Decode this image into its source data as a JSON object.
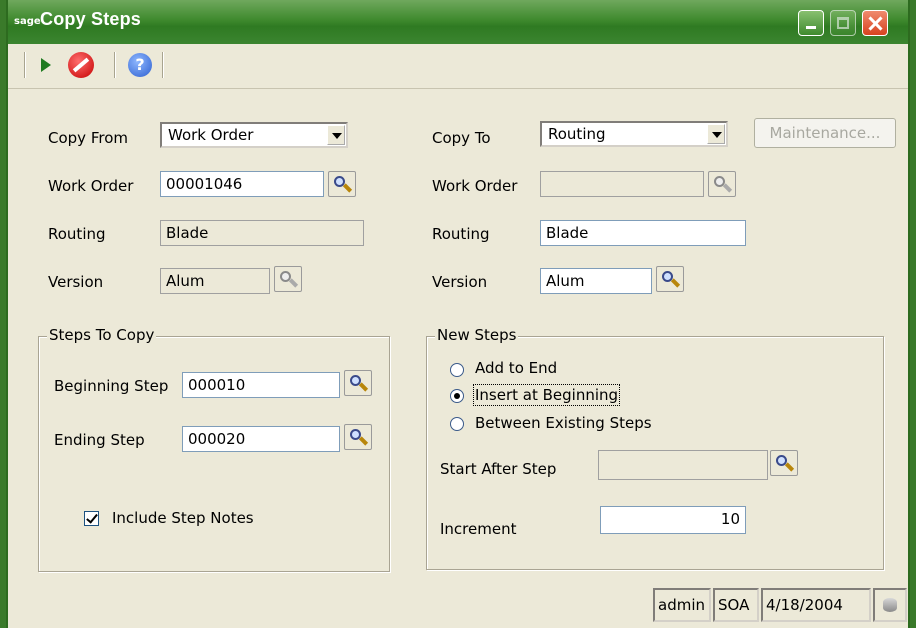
{
  "window": {
    "logo": "sage",
    "title": "Copy Steps"
  },
  "toolbar": {
    "accept": "accept-icon",
    "cancel": "cancel-icon",
    "help": "?"
  },
  "left": {
    "copy_from_label": "Copy From",
    "copy_from_value": "Work Order",
    "work_order_label": "Work Order",
    "work_order_value": "00001046",
    "routing_label": "Routing",
    "routing_value": "Blade",
    "version_label": "Version",
    "version_value": "Alum"
  },
  "right": {
    "copy_to_label": "Copy To",
    "copy_to_value": "Routing",
    "maintenance_button": "Maintenance...",
    "work_order_label": "Work Order",
    "work_order_value": "",
    "routing_label": "Routing",
    "routing_value": "Blade",
    "version_label": "Version",
    "version_value": "Alum"
  },
  "steps_to_copy": {
    "title": "Steps To Copy",
    "beginning_label": "Beginning Step",
    "beginning_value": "000010",
    "ending_label": "Ending Step",
    "ending_value": "000020",
    "include_notes_label": "Include Step Notes",
    "include_notes_checked": true
  },
  "new_steps": {
    "title": "New Steps",
    "options": [
      "Add to End",
      "Insert at Beginning",
      "Between Existing Steps"
    ],
    "selected": "Insert at Beginning",
    "start_after_label": "Start After Step",
    "start_after_value": "",
    "increment_label": "Increment",
    "increment_value": "10"
  },
  "statusbar": {
    "user": "admin",
    "company": "SOA",
    "date": "4/18/2004",
    "db": "database-icon"
  },
  "colors": {
    "titlebar": "#3f8a2e",
    "window_bg": "#ece9d8"
  }
}
